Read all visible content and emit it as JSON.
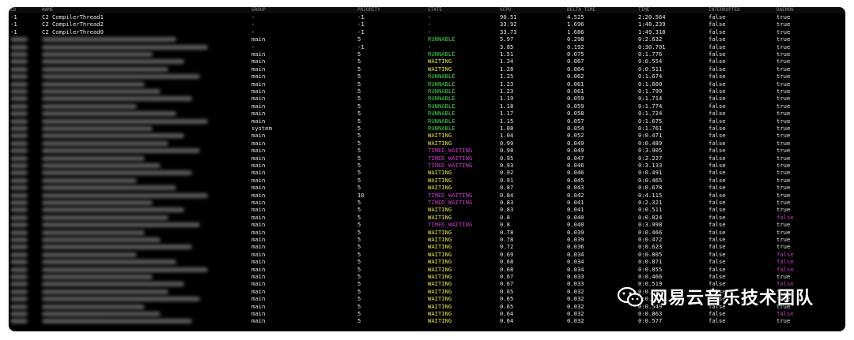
{
  "headers": {
    "id": "ID",
    "name": "NAME",
    "group": "GROUP",
    "priority": "PRIORITY",
    "state": "STATE",
    "cpu": "%CPU",
    "delta_time": "DELTA_TIME",
    "time": "TIME",
    "interrupted": "INTERRUPTED",
    "daemon": "DAEMON"
  },
  "rows": [
    {
      "id": "-1",
      "name": "C2 CompilerThread1",
      "group": "-",
      "priority": "-1",
      "state": "-",
      "cpu": "90.51",
      "delta": "4.525",
      "time": "2:20.564",
      "interrupted": "false",
      "daemon": "true"
    },
    {
      "id": "-1",
      "name": "C2 CompilerThread2",
      "group": "-",
      "priority": "-1",
      "state": "-",
      "cpu": "33.92",
      "delta": "1.696",
      "time": "1:48.239",
      "interrupted": "false",
      "daemon": "true"
    },
    {
      "id": "-1",
      "name": "C2 CompilerThread0",
      "group": "-",
      "priority": "-1",
      "state": "-",
      "cpu": "33.73",
      "delta": "1.686",
      "time": "1:49.318",
      "interrupted": "false",
      "daemon": "true"
    },
    {
      "id": "",
      "name": "",
      "group": "main",
      "priority": "5",
      "state": "RUNNABLE",
      "cpu": "5.97",
      "delta": "0.298",
      "time": "0:2.632",
      "interrupted": "false",
      "daemon": "true"
    },
    {
      "id": "",
      "name": "",
      "group": "-",
      "priority": "-1",
      "state": "-",
      "cpu": "3.85",
      "delta": "0.192",
      "time": "0:30.701",
      "interrupted": "false",
      "daemon": "true"
    },
    {
      "id": "",
      "name": "",
      "group": "main",
      "priority": "5",
      "state": "RUNNABLE",
      "cpu": "1.51",
      "delta": "0.075",
      "time": "0:1.776",
      "interrupted": "false",
      "daemon": "true"
    },
    {
      "id": "",
      "name": "",
      "group": "main",
      "priority": "5",
      "state": "WAITING",
      "cpu": "1.34",
      "delta": "0.067",
      "time": "0:0.554",
      "interrupted": "false",
      "daemon": "true"
    },
    {
      "id": "",
      "name": "",
      "group": "main",
      "priority": "5",
      "state": "WAITING",
      "cpu": "1.28",
      "delta": "0.064",
      "time": "0:0.511",
      "interrupted": "false",
      "daemon": "true"
    },
    {
      "id": "",
      "name": "",
      "group": "main",
      "priority": "5",
      "state": "RUNNABLE",
      "cpu": "1.25",
      "delta": "0.062",
      "time": "0:1.674",
      "interrupted": "false",
      "daemon": "true"
    },
    {
      "id": "",
      "name": "",
      "group": "main",
      "priority": "5",
      "state": "RUNNABLE",
      "cpu": "1.23",
      "delta": "0.061",
      "time": "0:1.660",
      "interrupted": "false",
      "daemon": "true"
    },
    {
      "id": "",
      "name": "",
      "group": "main",
      "priority": "5",
      "state": "RUNNABLE",
      "cpu": "1.23",
      "delta": "0.061",
      "time": "0:1.799",
      "interrupted": "false",
      "daemon": "true"
    },
    {
      "id": "",
      "name": "",
      "group": "main",
      "priority": "5",
      "state": "RUNNABLE",
      "cpu": "1.19",
      "delta": "0.059",
      "time": "0:1.714",
      "interrupted": "false",
      "daemon": "true"
    },
    {
      "id": "",
      "name": "",
      "group": "main",
      "priority": "5",
      "state": "RUNNABLE",
      "cpu": "1.18",
      "delta": "0.059",
      "time": "0:1.774",
      "interrupted": "false",
      "daemon": "true"
    },
    {
      "id": "",
      "name": "",
      "group": "main",
      "priority": "5",
      "state": "RUNNABLE",
      "cpu": "1.17",
      "delta": "0.058",
      "time": "0:1.724",
      "interrupted": "false",
      "daemon": "true"
    },
    {
      "id": "",
      "name": "",
      "group": "main",
      "priority": "5",
      "state": "RUNNABLE",
      "cpu": "1.15",
      "delta": "0.057",
      "time": "0:1.675",
      "interrupted": "false",
      "daemon": "true"
    },
    {
      "id": "",
      "name": "",
      "group": "system",
      "priority": "5",
      "state": "RUNNABLE",
      "cpu": "1.08",
      "delta": "0.054",
      "time": "0:1.761",
      "interrupted": "false",
      "daemon": "true"
    },
    {
      "id": "",
      "name": "",
      "group": "main",
      "priority": "5",
      "state": "WAITING",
      "cpu": "1.04",
      "delta": "0.052",
      "time": "0:0.471",
      "interrupted": "false",
      "daemon": "true"
    },
    {
      "id": "",
      "name": "",
      "group": "main",
      "priority": "5",
      "state": "WAITING",
      "cpu": "0.99",
      "delta": "0.049",
      "time": "0:0.489",
      "interrupted": "false",
      "daemon": "true"
    },
    {
      "id": "",
      "name": "",
      "group": "main",
      "priority": "5",
      "state": "TIMED_WAITING",
      "cpu": "0.98",
      "delta": "0.049",
      "time": "0:3.905",
      "interrupted": "false",
      "daemon": "true"
    },
    {
      "id": "",
      "name": "",
      "group": "main",
      "priority": "5",
      "state": "TIMED_WAITING",
      "cpu": "0.95",
      "delta": "0.047",
      "time": "0:2.227",
      "interrupted": "false",
      "daemon": "true"
    },
    {
      "id": "",
      "name": "",
      "group": "main",
      "priority": "5",
      "state": "TIMED_WAITING",
      "cpu": "0.93",
      "delta": "0.046",
      "time": "0:3.133",
      "interrupted": "false",
      "daemon": "true"
    },
    {
      "id": "",
      "name": "",
      "group": "main",
      "priority": "5",
      "state": "WAITING",
      "cpu": "0.92",
      "delta": "0.046",
      "time": "0:0.491",
      "interrupted": "false",
      "daemon": "true"
    },
    {
      "id": "",
      "name": "",
      "group": "main",
      "priority": "5",
      "state": "WAITING",
      "cpu": "0.91",
      "delta": "0.045",
      "time": "0:0.465",
      "interrupted": "false",
      "daemon": "true"
    },
    {
      "id": "",
      "name": "",
      "group": "main",
      "priority": "5",
      "state": "WAITING",
      "cpu": "0.87",
      "delta": "0.043",
      "time": "0:0.678",
      "interrupted": "false",
      "daemon": "true"
    },
    {
      "id": "",
      "name": "",
      "group": "main",
      "priority": "10",
      "state": "TIMED_WAITING",
      "cpu": "0.84",
      "delta": "0.042",
      "time": "0:4.115",
      "interrupted": "false",
      "daemon": "true"
    },
    {
      "id": "",
      "name": "",
      "group": "main",
      "priority": "5",
      "state": "TIMED_WAITING",
      "cpu": "0.83",
      "delta": "0.041",
      "time": "0:2.321",
      "interrupted": "false",
      "daemon": "true"
    },
    {
      "id": "",
      "name": "",
      "group": "main",
      "priority": "5",
      "state": "WAITING",
      "cpu": "0.83",
      "delta": "0.041",
      "time": "0:0.511",
      "interrupted": "false",
      "daemon": "true"
    },
    {
      "id": "",
      "name": "",
      "group": "main",
      "priority": "5",
      "state": "WAITING",
      "cpu": "0.8",
      "delta": "0.040",
      "time": "0:0.824",
      "interrupted": "false",
      "daemon": "false"
    },
    {
      "id": "",
      "name": "",
      "group": "main",
      "priority": "5",
      "state": "TIMED_WAITING",
      "cpu": "0.8",
      "delta": "0.040",
      "time": "0:3.998",
      "interrupted": "false",
      "daemon": "true"
    },
    {
      "id": "",
      "name": "",
      "group": "main",
      "priority": "5",
      "state": "WAITING",
      "cpu": "0.78",
      "delta": "0.039",
      "time": "0:0.466",
      "interrupted": "false",
      "daemon": "true"
    },
    {
      "id": "",
      "name": "",
      "group": "main",
      "priority": "5",
      "state": "WAITING",
      "cpu": "0.78",
      "delta": "0.039",
      "time": "0:0.472",
      "interrupted": "false",
      "daemon": "true"
    },
    {
      "id": "",
      "name": "",
      "group": "main",
      "priority": "5",
      "state": "WAITING",
      "cpu": "0.72",
      "delta": "0.036",
      "time": "0:0.623",
      "interrupted": "false",
      "daemon": "true"
    },
    {
      "id": "",
      "name": "",
      "group": "main",
      "priority": "5",
      "state": "WAITING",
      "cpu": "0.69",
      "delta": "0.034",
      "time": "0:0.805",
      "interrupted": "false",
      "daemon": "false"
    },
    {
      "id": "",
      "name": "",
      "group": "main",
      "priority": "5",
      "state": "WAITING",
      "cpu": "0.68",
      "delta": "0.034",
      "time": "0:0.871",
      "interrupted": "false",
      "daemon": "false"
    },
    {
      "id": "",
      "name": "",
      "group": "main",
      "priority": "5",
      "state": "WAITING",
      "cpu": "0.68",
      "delta": "0.034",
      "time": "0:0.855",
      "interrupted": "false",
      "daemon": "false"
    },
    {
      "id": "",
      "name": "",
      "group": "main",
      "priority": "5",
      "state": "WAITING",
      "cpu": "0.67",
      "delta": "0.033",
      "time": "0:0.466",
      "interrupted": "false",
      "daemon": "true"
    },
    {
      "id": "",
      "name": "",
      "group": "main",
      "priority": "5",
      "state": "WAITING",
      "cpu": "0.67",
      "delta": "0.033",
      "time": "0:0.519",
      "interrupted": "false",
      "daemon": "false"
    },
    {
      "id": "",
      "name": "",
      "group": "main",
      "priority": "5",
      "state": "WAITING",
      "cpu": "0.65",
      "delta": "0.032",
      "time": "0:0.578",
      "interrupted": "false",
      "daemon": "true"
    },
    {
      "id": "",
      "name": "",
      "group": "main",
      "priority": "5",
      "state": "WAITING",
      "cpu": "0.65",
      "delta": "0.032",
      "time": "0:0.563",
      "interrupted": "false",
      "daemon": "true"
    },
    {
      "id": "",
      "name": "",
      "group": "main",
      "priority": "5",
      "state": "WAITING",
      "cpu": "0.65",
      "delta": "0.032",
      "time": "0:0.549",
      "interrupted": "false",
      "daemon": "true"
    },
    {
      "id": "",
      "name": "",
      "group": "main",
      "priority": "5",
      "state": "WAITING",
      "cpu": "0.64",
      "delta": "0.032",
      "time": "0:0.863",
      "interrupted": "false",
      "daemon": "false"
    },
    {
      "id": "",
      "name": "",
      "group": "main",
      "priority": "5",
      "state": "WAITING",
      "cpu": "0.64",
      "delta": "0.032",
      "time": "0:0.577",
      "interrupted": "false",
      "daemon": "true"
    }
  ],
  "colors": {
    "runnable": "#3fcf4a",
    "waiting": "#e4e23d",
    "timed_waiting": "#c93ac9",
    "daemon_false": "#c93ac9",
    "background": "#000000"
  },
  "watermark": {
    "icon": "wechat-icon",
    "text": "网易云音乐技术团队"
  }
}
